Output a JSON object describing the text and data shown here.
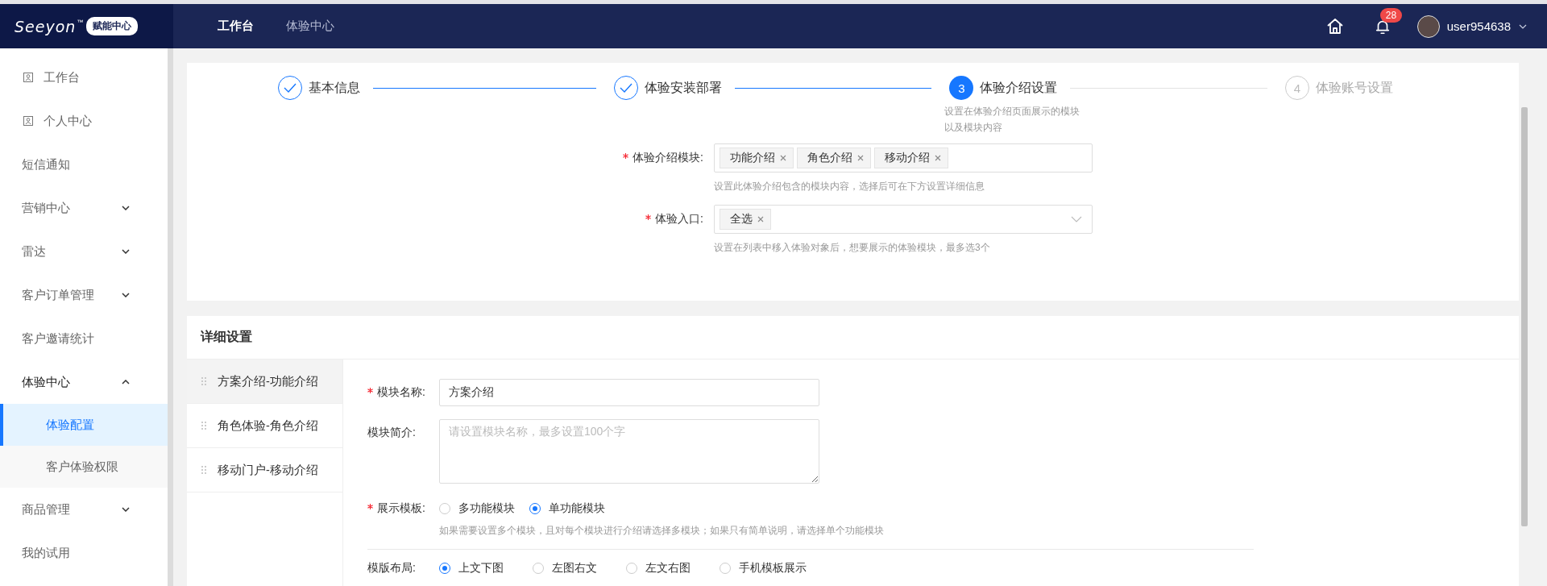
{
  "header": {
    "logo_text": "Seeyon",
    "trademark": "™",
    "badge": "赋能中心",
    "nav": [
      {
        "label": "工作台",
        "selected": true
      },
      {
        "label": "体验中心",
        "selected": false
      }
    ],
    "notification_count": "28",
    "user": "user954638"
  },
  "sidebar": {
    "items": [
      {
        "label": "工作台",
        "kind": "icon-link",
        "selected": false
      },
      {
        "label": "个人中心",
        "kind": "icon-link",
        "selected": false
      },
      {
        "label": "短信通知",
        "kind": "link",
        "selected": false
      },
      {
        "label": "营销中心",
        "kind": "group",
        "expanded": false,
        "selected": false
      },
      {
        "label": "雷达",
        "kind": "group",
        "expanded": false,
        "selected": false
      },
      {
        "label": "客户订单管理",
        "kind": "group",
        "expanded": false,
        "selected": false
      },
      {
        "label": "客户邀请统计",
        "kind": "link",
        "selected": false
      },
      {
        "label": "体验中心",
        "kind": "group",
        "expanded": true,
        "selected": false,
        "children": [
          {
            "label": "体验配置",
            "selected": true
          },
          {
            "label": "客户体验权限",
            "selected": false
          }
        ]
      },
      {
        "label": "商品管理",
        "kind": "group",
        "expanded": false,
        "selected": false
      },
      {
        "label": "我的试用",
        "kind": "link",
        "selected": false
      }
    ]
  },
  "steps": [
    {
      "title": "基本信息",
      "done": true,
      "active": false
    },
    {
      "title": "体验安装部署",
      "done": true,
      "active": false
    },
    {
      "number": "3",
      "title": "体验介绍设置",
      "done": false,
      "active": true,
      "description": "设置在体验介绍页面展示的模块以及模块内容"
    },
    {
      "number": "4",
      "title": "体验账号设置",
      "done": false,
      "active": false
    }
  ],
  "intro_form": [
    {
      "label": "体验介绍模块:",
      "required": true,
      "tags": [
        "功能介绍",
        "角色介绍",
        "移动介绍"
      ],
      "dropdown": false,
      "hint": "设置此体验介绍包含的模块内容，选择后可在下方设置详细信息"
    },
    {
      "label": "体验入口:",
      "required": true,
      "tags": [
        "全选"
      ],
      "dropdown": true,
      "hint": "设置在列表中移入体验对象后，想要展示的体验模块，最多选3个"
    }
  ],
  "detail": {
    "title": "详细设置",
    "modules": [
      {
        "label": "方案介绍-功能介绍",
        "selected": true
      },
      {
        "label": "角色体验-角色介绍",
        "selected": false
      },
      {
        "label": "移动门户-移动介绍",
        "selected": false
      }
    ],
    "name_field": {
      "label": "模块名称:",
      "required": true,
      "value": "方案介绍"
    },
    "summary_field": {
      "label": "模块简介:",
      "required": false,
      "placeholder": "请设置模块名称，最多设置100个字"
    },
    "template": {
      "label": "展示模板:",
      "required": true,
      "options": [
        {
          "label": "多功能模块",
          "selected": false
        },
        {
          "label": "单功能模块",
          "selected": true
        }
      ],
      "hint": "如果需要设置多个模块，且对每个模块进行介绍请选择多模块；如果只有简单说明，请选择单个功能模块"
    },
    "layout": {
      "label": "模版布局:",
      "required": false,
      "options": [
        {
          "label": "上文下图",
          "selected": true
        },
        {
          "label": "左图右文",
          "selected": false
        },
        {
          "label": "左文右图",
          "selected": false
        },
        {
          "label": "手机模板展示",
          "selected": false
        }
      ]
    }
  }
}
